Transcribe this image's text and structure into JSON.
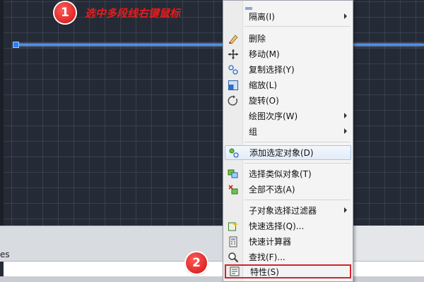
{
  "annotations": {
    "step1_number": "1",
    "step1_text": "选中多段线右键鼠标",
    "step2_number": "2"
  },
  "bottom_panel": {
    "text": "es"
  },
  "context_menu": {
    "items": [
      {
        "label": "隔离(I)",
        "submenu": true,
        "icon": ""
      },
      {
        "label": "删除",
        "submenu": false,
        "icon": "eraser-icon"
      },
      {
        "label": "移动(M)",
        "submenu": false,
        "icon": "move-icon"
      },
      {
        "label": "复制选择(Y)",
        "submenu": false,
        "icon": "copy-icon"
      },
      {
        "label": "缩放(L)",
        "submenu": false,
        "icon": "scale-icon"
      },
      {
        "label": "旋转(O)",
        "submenu": false,
        "icon": "rotate-icon"
      },
      {
        "label": "绘图次序(W)",
        "submenu": true,
        "icon": ""
      },
      {
        "label": "组",
        "submenu": true,
        "icon": ""
      },
      {
        "label": "添加选定对象(D)",
        "submenu": false,
        "icon": "add-selected-icon"
      },
      {
        "label": "选择类似对象(T)",
        "submenu": false,
        "icon": "select-similar-icon"
      },
      {
        "label": "全部不选(A)",
        "submenu": false,
        "icon": "deselect-all-icon"
      },
      {
        "label": "子对象选择过滤器",
        "submenu": true,
        "icon": ""
      },
      {
        "label": "快速选择(Q)...",
        "submenu": false,
        "icon": "quick-select-icon"
      },
      {
        "label": "快速计算器",
        "submenu": false,
        "icon": "calculator-icon"
      },
      {
        "label": "查找(F)...",
        "submenu": false,
        "icon": "find-icon"
      },
      {
        "label": "特性(S)",
        "submenu": false,
        "icon": "properties-icon"
      }
    ]
  },
  "colors": {
    "canvas": "#252b36",
    "polyline": "#4f8fe6",
    "badge": "#d21212",
    "annotation_text": "#e61c1c",
    "menu_bg": "#f4f4f4",
    "highlight_border": "#d3242c"
  }
}
